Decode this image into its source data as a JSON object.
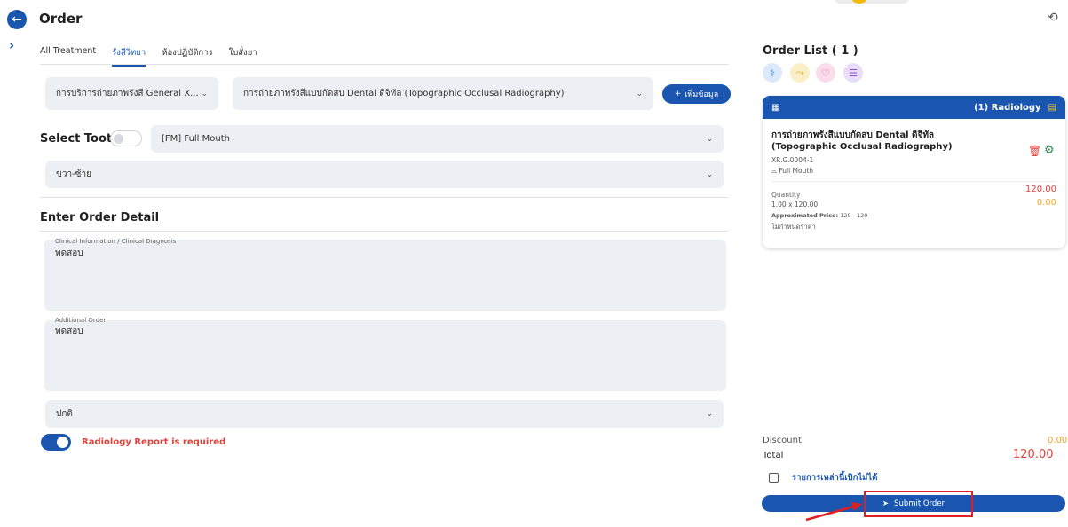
{
  "header": {
    "title": "Order"
  },
  "tabs": [
    {
      "label": "All Treatment",
      "active": false
    },
    {
      "label": "รังสีวิทยา",
      "active": true
    },
    {
      "label": "ห้องปฏิบัติการ",
      "active": false
    },
    {
      "label": "ใบสั่งยา",
      "active": false
    }
  ],
  "filters": {
    "service_select": "การบริการถ่ายภาพรังสี General X...",
    "procedure_select": "การถ่ายภาพรังสีแบบกัดสบ Dental ดิจิทัล (Topographic Occlusal Radiography)",
    "add_label": "เพิ่มข้อมูล"
  },
  "tooth": {
    "label": "Select Tooth",
    "tooth_select": "[FM] Full Mouth",
    "side_select": "ขวา-ซ้าย"
  },
  "order_detail": {
    "title": "Enter Order Detail",
    "clinical_label": "Clinical Information / Clinical Diagnosis",
    "clinical_value": "ทดสอบ",
    "additional_label": "Additional Order",
    "additional_value": "ทดสอบ",
    "priority_select": "ปกติ",
    "radiology_required_label": "Radiology Report is required"
  },
  "order_list": {
    "title": "Order List ( 1 )",
    "chips": [
      {
        "icon": "patient-icon",
        "color": "#2f7fd6",
        "bg": "#dbe9fb"
      },
      {
        "icon": "route-icon",
        "color": "#e0a400",
        "bg": "#fbefc7"
      },
      {
        "icon": "heart-icon",
        "color": "#e04a8a",
        "bg": "#fbdcea"
      },
      {
        "icon": "list-icon",
        "color": "#8a4fd8",
        "bg": "#e9ddfb"
      }
    ],
    "card": {
      "header_count": "(1)  Radiology",
      "title": "การถ่ายภาพรังสีแบบกัดสบ Dental ดิจิทัล (Topographic Occlusal Radiography)",
      "code": "XR.G.0004-1",
      "mouth": "Full Mouth",
      "quantity_label": "Quantity",
      "quantity_value": "1.00 x 120.00",
      "approx_label": "Approximated Price:",
      "approx_value": "120 - 120",
      "no_price": "ไม่กำหนดราคา",
      "amount": "120.00",
      "amount_secondary": "0.00"
    },
    "discount_label": "Discount",
    "discount_value": "0.00",
    "total_label": "Total",
    "total_value": "120.00",
    "nonpayable_label": "รายการเหล่านี้เบิกไม่ได้",
    "submit_label": "Submit Order"
  }
}
